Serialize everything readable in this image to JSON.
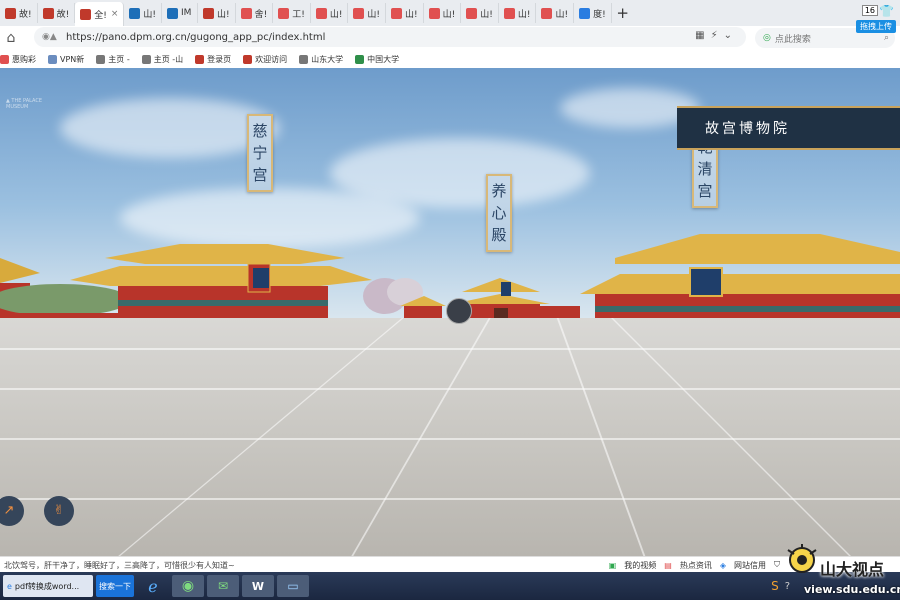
{
  "browser": {
    "tabs": [
      {
        "label": "故!",
        "color": "#c0392b"
      },
      {
        "label": "故!",
        "color": "#c0392b"
      },
      {
        "label": "全!",
        "color": "#c0392b",
        "active": true
      },
      {
        "label": "山!",
        "color": "#1e6fb8"
      },
      {
        "label": "IM",
        "color": "#1e6fb8"
      },
      {
        "label": "山!",
        "color": "#c0392b"
      },
      {
        "label": "舍!",
        "color": "#e05050"
      },
      {
        "label": "工!",
        "color": "#e05050"
      },
      {
        "label": "山!",
        "color": "#e05050"
      },
      {
        "label": "山!",
        "color": "#e05050"
      },
      {
        "label": "山!",
        "color": "#e05050"
      },
      {
        "label": "山!",
        "color": "#e05050"
      },
      {
        "label": "山!",
        "color": "#e05050"
      },
      {
        "label": "山!",
        "color": "#e05050"
      },
      {
        "label": "山!",
        "color": "#e05050"
      },
      {
        "label": "度!",
        "color": "#2a7de1"
      }
    ],
    "new_tab": "+",
    "tab_count": "16",
    "url": "https://pano.dpm.org.cn/gugong_app_pc/index.html",
    "search_placeholder": "点此搜索",
    "side_badge": "拖拽上传",
    "bookmarks": [
      {
        "label": "惠购彩",
        "color": "#e05050"
      },
      {
        "label": "VPN新",
        "color": "#6b8dbf"
      },
      {
        "label": "主页 -",
        "color": "#777777"
      },
      {
        "label": "主页 -山",
        "color": "#777777"
      },
      {
        "label": "登录页",
        "color": "#c0392b"
      },
      {
        "label": "欢迎访问",
        "color": "#c0392b"
      },
      {
        "label": "山东大学",
        "color": "#777777"
      },
      {
        "label": "中国大学",
        "color": "#2f8f4a"
      }
    ]
  },
  "scene": {
    "title": "故宫博物院",
    "banners": [
      {
        "text": "慈\n宁\n宫"
      },
      {
        "text": "养\n心\n殿"
      },
      {
        "text": "乾\n清\n宫"
      }
    ],
    "sky_color": "#8fb6db",
    "wall_color": "#b8342a",
    "roof_color": "#e0b448"
  },
  "status": {
    "news": "北饮驾号，肝干净了，睡眠好了，三高降了，可惜很少有人知道~",
    "items": [
      "我的视频",
      "热点资讯",
      "网站信用"
    ]
  },
  "taskbar": {
    "items": [
      "pdf转换成word...",
      "搜索一下"
    ]
  },
  "watermark": {
    "text": "山大视点",
    "url": "view.sdu.edu.cn"
  }
}
